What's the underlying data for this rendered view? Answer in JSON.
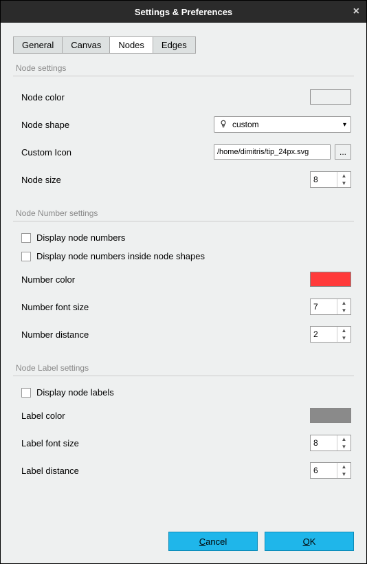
{
  "window": {
    "title": "Settings & Preferences"
  },
  "tabs": {
    "general": "General",
    "canvas": "Canvas",
    "nodes": "Nodes",
    "edges": "Edges",
    "active": "nodes"
  },
  "sections": {
    "node_settings": {
      "title": "Node settings",
      "node_color_label": "Node color",
      "node_color": "#ff1a1a",
      "node_shape_label": "Node shape",
      "node_shape_value": "custom",
      "custom_icon_label": "Custom Icon",
      "custom_icon_path": "/home/dimitris/tip_24px.svg",
      "node_size_label": "Node size",
      "node_size_value": "8"
    },
    "node_number_settings": {
      "title": "Node Number settings",
      "display_numbers_label": "Display node numbers",
      "display_numbers_checked": false,
      "display_inside_label": "Display node numbers inside node shapes",
      "display_inside_checked": false,
      "number_color_label": "Number color",
      "number_color": "#ff3a3a",
      "number_font_size_label": "Number font size",
      "number_font_size_value": "7",
      "number_distance_label": "Number distance",
      "number_distance_value": "2"
    },
    "node_label_settings": {
      "title": "Node Label settings",
      "display_labels_label": "Display node labels",
      "display_labels_checked": false,
      "label_color_label": "Label color",
      "label_color": "#8a8a8a",
      "label_font_size_label": "Label font size",
      "label_font_size_value": "8",
      "label_distance_label": "Label distance",
      "label_distance_value": "6"
    }
  },
  "buttons": {
    "cancel": "Cancel",
    "ok": "OK"
  },
  "browse": "..."
}
